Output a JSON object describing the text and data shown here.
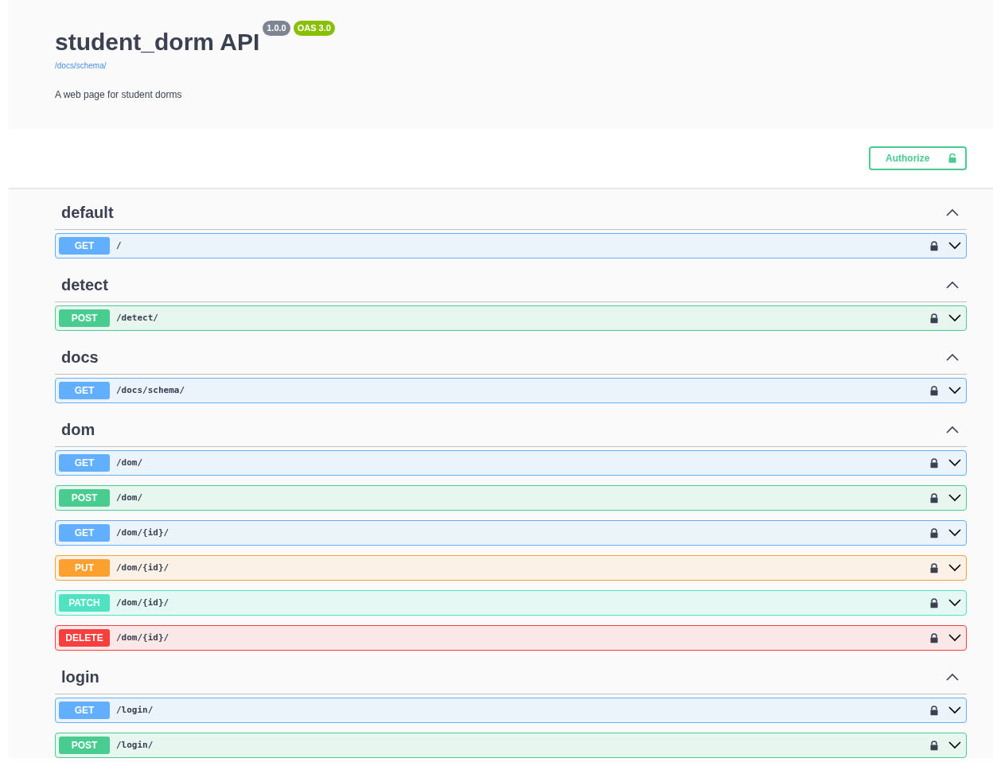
{
  "header": {
    "title": "student_dorm API",
    "version": "1.0.0",
    "oas": "OAS 3.0",
    "schema_link": "/docs/schema/",
    "description": "A web page for student dorms"
  },
  "authorize": {
    "label": "Authorize"
  },
  "sections": [
    {
      "name": "default",
      "expanded": true,
      "operations": [
        {
          "method": "GET",
          "path": "/"
        }
      ]
    },
    {
      "name": "detect",
      "expanded": true,
      "operations": [
        {
          "method": "POST",
          "path": "/detect/"
        }
      ]
    },
    {
      "name": "docs",
      "expanded": true,
      "operations": [
        {
          "method": "GET",
          "path": "/docs/schema/"
        }
      ]
    },
    {
      "name": "dom",
      "expanded": true,
      "operations": [
        {
          "method": "GET",
          "path": "/dom/"
        },
        {
          "method": "POST",
          "path": "/dom/"
        },
        {
          "method": "GET",
          "path": "/dom/{id}/"
        },
        {
          "method": "PUT",
          "path": "/dom/{id}/"
        },
        {
          "method": "PATCH",
          "path": "/dom/{id}/"
        },
        {
          "method": "DELETE",
          "path": "/dom/{id}/"
        }
      ]
    },
    {
      "name": "login",
      "expanded": true,
      "operations": [
        {
          "method": "GET",
          "path": "/login/"
        },
        {
          "method": "POST",
          "path": "/login/"
        }
      ]
    }
  ]
}
